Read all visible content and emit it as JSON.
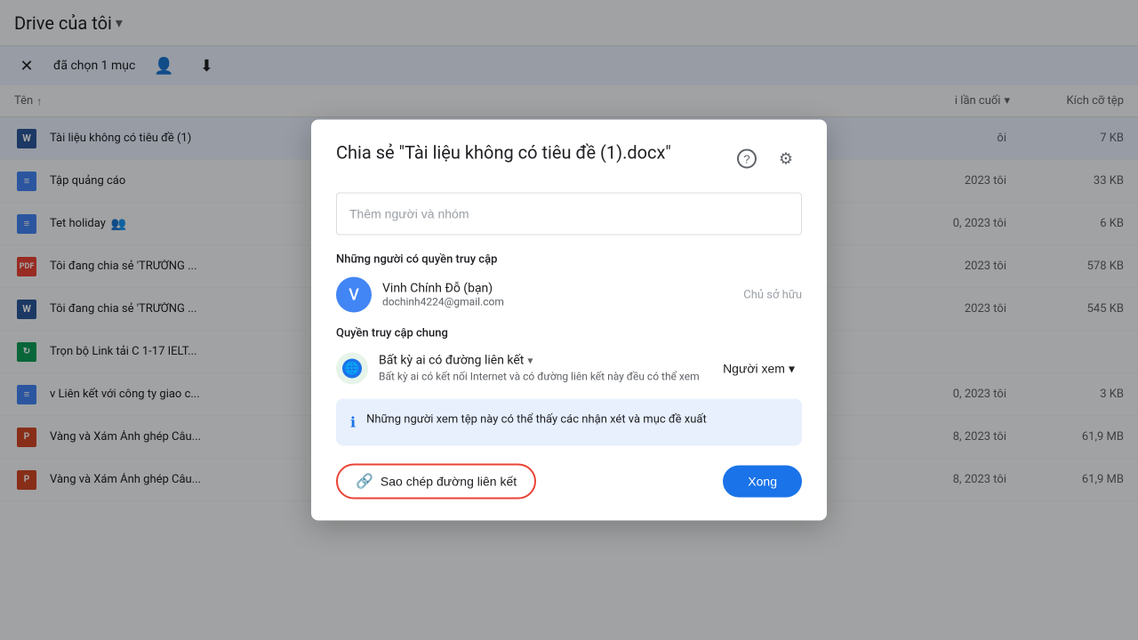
{
  "drive": {
    "title": "Drive của tôi",
    "title_arrow": "▾"
  },
  "actionbar": {
    "close_label": "✕",
    "selected_text": "đã chọn 1 mục",
    "add_person_icon": "👤+",
    "download_icon": "⬇"
  },
  "list_header": {
    "name_col": "Tên",
    "sort_icon": "↑",
    "modified_col": "i lần cuối",
    "modified_arrow": "▾",
    "size_col": "Kích cỡ tệp"
  },
  "files": [
    {
      "name": "Tài liệu không có tiêu đề (1)",
      "icon_type": "word",
      "icon_label": "W",
      "modified": "ôi",
      "size": "7 KB",
      "selected": true
    },
    {
      "name": "Tập quảng cáo",
      "icon_type": "doc",
      "icon_label": "≡",
      "modified": "2023 tôi",
      "size": "33 KB",
      "selected": false
    },
    {
      "name": "Tet holiday",
      "icon_type": "doc",
      "icon_label": "≡",
      "modified": "0, 2023 tôi",
      "size": "6 KB",
      "selected": false,
      "shared": true
    },
    {
      "name": "Tôi đang chia sẻ 'TRƯỜNG ...",
      "icon_type": "pdf",
      "icon_label": "PDF",
      "modified": "2023 tôi",
      "size": "578 KB",
      "selected": false
    },
    {
      "name": "Tôi đang chia sẻ 'TRƯỜNG ...",
      "icon_type": "word",
      "icon_label": "W",
      "modified": "2023 tôi",
      "size": "545 KB",
      "selected": false
    },
    {
      "name": "Trọn bộ Link tải C 1-17 IELT...",
      "icon_type": "sheets",
      "icon_label": "↻",
      "modified": "",
      "size": "",
      "selected": false
    },
    {
      "name": "v Liên kết với công ty giao c...",
      "icon_type": "doc",
      "icon_label": "≡",
      "modified": "0, 2023 tôi",
      "size": "3 KB",
      "selected": false
    },
    {
      "name": "Vàng và Xám Ảnh ghép Câu...",
      "icon_type": "ppt",
      "icon_label": "P",
      "modified": "8, 2023 tôi",
      "size": "61,9 MB",
      "selected": false
    },
    {
      "name": "Vàng và Xám Ảnh ghép Câu...",
      "icon_type": "ppt",
      "icon_label": "P",
      "modified": "8, 2023 tôi",
      "size": "61,9 MB",
      "selected": false
    }
  ],
  "modal": {
    "title": "Chia sẻ \"Tài liệu không có tiêu đề (1).docx\"",
    "help_icon": "?",
    "settings_icon": "⚙",
    "search_placeholder": "Thêm người và nhóm",
    "access_section_title": "Những người có quyền truy cập",
    "user": {
      "avatar_letter": "V",
      "name": "Vinh Chính Đỗ (bạn)",
      "email": "dochinh4224@gmail.com",
      "role": "Chủ sở hữu"
    },
    "general_access_title": "Quyền truy cập chung",
    "link_label": "Bất kỳ ai có đường liên kết",
    "link_desc": "Bất kỳ ai có kết nối Internet và có đường liên kết này đều có thể xem",
    "viewer_role": "Người xem",
    "info_text": "Những người xem tệp này có thể thấy các nhận xét và mục đề xuất",
    "copy_btn_label": "Sao chép đường liên kết",
    "done_btn_label": "Xong"
  }
}
